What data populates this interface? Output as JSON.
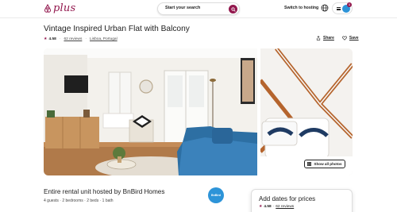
{
  "brand": {
    "name": "plus",
    "color": "#92174d"
  },
  "header": {
    "search_label": "Start your search",
    "host_link": "Switch to hosting",
    "notification_count": "1"
  },
  "listing": {
    "title": "Vintage Inspired Urban Flat with Balcony",
    "rating": "4.58",
    "reviews": "62 reviews",
    "location": "Lisboa, Portugal",
    "share_label": "Share",
    "save_label": "Save",
    "show_all_photos": "Show all photos"
  },
  "host": {
    "title": "Entire rental unit hosted by BnBird Homes",
    "details": "4 guests · 2 bedrooms · 2 beds · 1 bath",
    "avatar_text": "BnBird"
  },
  "booking": {
    "title": "Add dates for prices",
    "rating": "4.58",
    "reviews": "62 reviews"
  }
}
